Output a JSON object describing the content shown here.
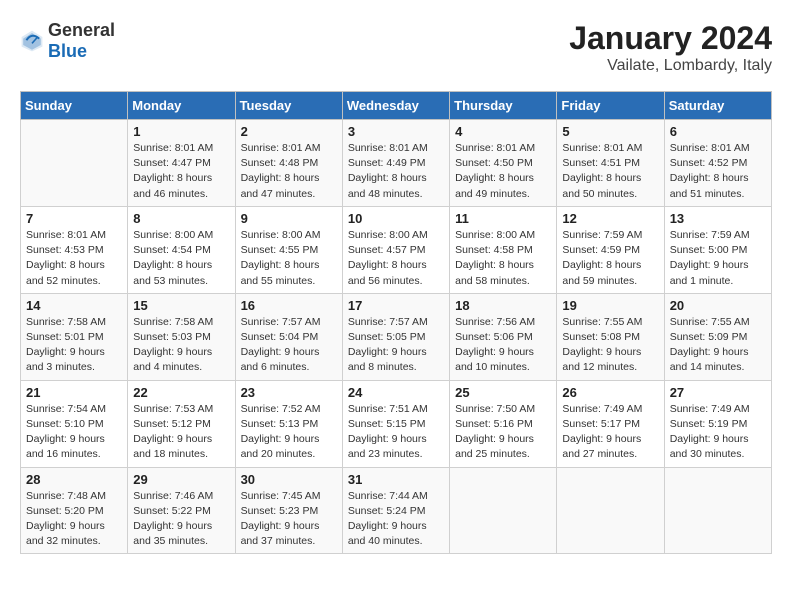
{
  "header": {
    "logo_general": "General",
    "logo_blue": "Blue",
    "title": "January 2024",
    "subtitle": "Vailate, Lombardy, Italy"
  },
  "columns": [
    "Sunday",
    "Monday",
    "Tuesday",
    "Wednesday",
    "Thursday",
    "Friday",
    "Saturday"
  ],
  "weeks": [
    [
      {
        "day": "",
        "info": ""
      },
      {
        "day": "1",
        "info": "Sunrise: 8:01 AM\nSunset: 4:47 PM\nDaylight: 8 hours\nand 46 minutes."
      },
      {
        "day": "2",
        "info": "Sunrise: 8:01 AM\nSunset: 4:48 PM\nDaylight: 8 hours\nand 47 minutes."
      },
      {
        "day": "3",
        "info": "Sunrise: 8:01 AM\nSunset: 4:49 PM\nDaylight: 8 hours\nand 48 minutes."
      },
      {
        "day": "4",
        "info": "Sunrise: 8:01 AM\nSunset: 4:50 PM\nDaylight: 8 hours\nand 49 minutes."
      },
      {
        "day": "5",
        "info": "Sunrise: 8:01 AM\nSunset: 4:51 PM\nDaylight: 8 hours\nand 50 minutes."
      },
      {
        "day": "6",
        "info": "Sunrise: 8:01 AM\nSunset: 4:52 PM\nDaylight: 8 hours\nand 51 minutes."
      }
    ],
    [
      {
        "day": "7",
        "info": "Sunrise: 8:01 AM\nSunset: 4:53 PM\nDaylight: 8 hours\nand 52 minutes."
      },
      {
        "day": "8",
        "info": "Sunrise: 8:00 AM\nSunset: 4:54 PM\nDaylight: 8 hours\nand 53 minutes."
      },
      {
        "day": "9",
        "info": "Sunrise: 8:00 AM\nSunset: 4:55 PM\nDaylight: 8 hours\nand 55 minutes."
      },
      {
        "day": "10",
        "info": "Sunrise: 8:00 AM\nSunset: 4:57 PM\nDaylight: 8 hours\nand 56 minutes."
      },
      {
        "day": "11",
        "info": "Sunrise: 8:00 AM\nSunset: 4:58 PM\nDaylight: 8 hours\nand 58 minutes."
      },
      {
        "day": "12",
        "info": "Sunrise: 7:59 AM\nSunset: 4:59 PM\nDaylight: 8 hours\nand 59 minutes."
      },
      {
        "day": "13",
        "info": "Sunrise: 7:59 AM\nSunset: 5:00 PM\nDaylight: 9 hours\nand 1 minute."
      }
    ],
    [
      {
        "day": "14",
        "info": "Sunrise: 7:58 AM\nSunset: 5:01 PM\nDaylight: 9 hours\nand 3 minutes."
      },
      {
        "day": "15",
        "info": "Sunrise: 7:58 AM\nSunset: 5:03 PM\nDaylight: 9 hours\nand 4 minutes."
      },
      {
        "day": "16",
        "info": "Sunrise: 7:57 AM\nSunset: 5:04 PM\nDaylight: 9 hours\nand 6 minutes."
      },
      {
        "day": "17",
        "info": "Sunrise: 7:57 AM\nSunset: 5:05 PM\nDaylight: 9 hours\nand 8 minutes."
      },
      {
        "day": "18",
        "info": "Sunrise: 7:56 AM\nSunset: 5:06 PM\nDaylight: 9 hours\nand 10 minutes."
      },
      {
        "day": "19",
        "info": "Sunrise: 7:55 AM\nSunset: 5:08 PM\nDaylight: 9 hours\nand 12 minutes."
      },
      {
        "day": "20",
        "info": "Sunrise: 7:55 AM\nSunset: 5:09 PM\nDaylight: 9 hours\nand 14 minutes."
      }
    ],
    [
      {
        "day": "21",
        "info": "Sunrise: 7:54 AM\nSunset: 5:10 PM\nDaylight: 9 hours\nand 16 minutes."
      },
      {
        "day": "22",
        "info": "Sunrise: 7:53 AM\nSunset: 5:12 PM\nDaylight: 9 hours\nand 18 minutes."
      },
      {
        "day": "23",
        "info": "Sunrise: 7:52 AM\nSunset: 5:13 PM\nDaylight: 9 hours\nand 20 minutes."
      },
      {
        "day": "24",
        "info": "Sunrise: 7:51 AM\nSunset: 5:15 PM\nDaylight: 9 hours\nand 23 minutes."
      },
      {
        "day": "25",
        "info": "Sunrise: 7:50 AM\nSunset: 5:16 PM\nDaylight: 9 hours\nand 25 minutes."
      },
      {
        "day": "26",
        "info": "Sunrise: 7:49 AM\nSunset: 5:17 PM\nDaylight: 9 hours\nand 27 minutes."
      },
      {
        "day": "27",
        "info": "Sunrise: 7:49 AM\nSunset: 5:19 PM\nDaylight: 9 hours\nand 30 minutes."
      }
    ],
    [
      {
        "day": "28",
        "info": "Sunrise: 7:48 AM\nSunset: 5:20 PM\nDaylight: 9 hours\nand 32 minutes."
      },
      {
        "day": "29",
        "info": "Sunrise: 7:46 AM\nSunset: 5:22 PM\nDaylight: 9 hours\nand 35 minutes."
      },
      {
        "day": "30",
        "info": "Sunrise: 7:45 AM\nSunset: 5:23 PM\nDaylight: 9 hours\nand 37 minutes."
      },
      {
        "day": "31",
        "info": "Sunrise: 7:44 AM\nSunset: 5:24 PM\nDaylight: 9 hours\nand 40 minutes."
      },
      {
        "day": "",
        "info": ""
      },
      {
        "day": "",
        "info": ""
      },
      {
        "day": "",
        "info": ""
      }
    ]
  ]
}
